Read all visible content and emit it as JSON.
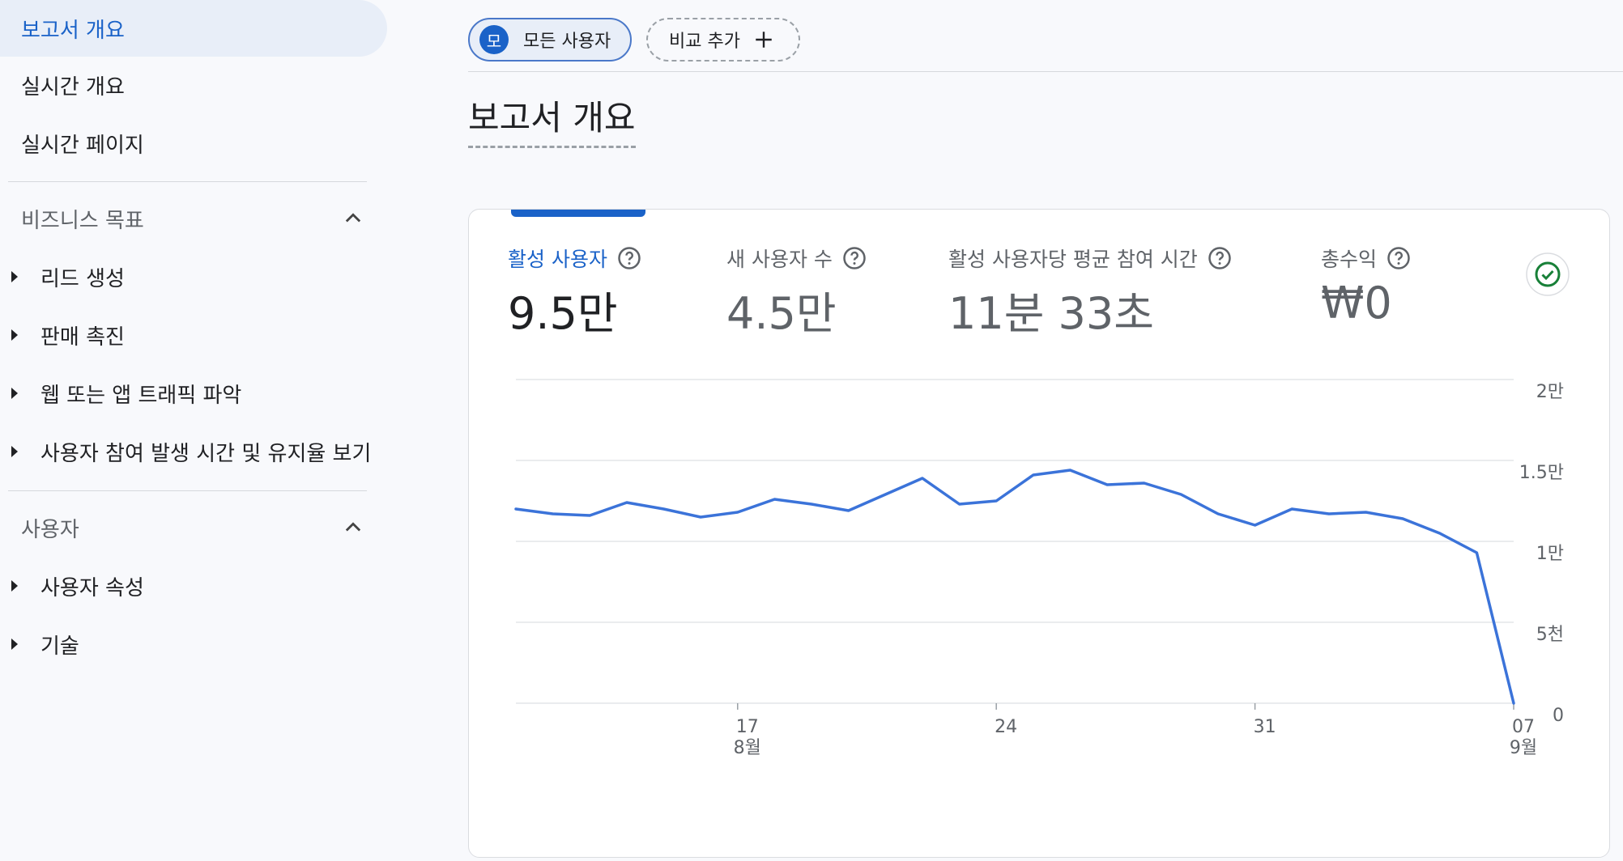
{
  "sidebar": {
    "top_items": [
      "보고서 개요",
      "실시간 개요",
      "실시간 페이지"
    ],
    "sections": [
      {
        "title": "비즈니스 목표",
        "items": [
          "리드 생성",
          "판매 촉진",
          "웹 또는 앱 트래픽 파악",
          "사용자 참여 발생 시간 및 유지율 보기"
        ]
      },
      {
        "title": "사용자",
        "items": [
          "사용자 속성",
          "기술"
        ]
      }
    ]
  },
  "toolbar": {
    "all_users_avatar": "모",
    "all_users_label": "모든 사용자",
    "add_comparison_label": "비교 추가"
  },
  "page": {
    "title": "보고서 개요"
  },
  "metrics": [
    {
      "label": "활성 사용자",
      "value": "9.5만"
    },
    {
      "label": "새 사용자 수",
      "value": "4.5만"
    },
    {
      "label": "활성 사용자당 평균 참여 시간",
      "value": "11분 33초"
    },
    {
      "label": "총수익",
      "value": "₩0"
    }
  ],
  "colors": {
    "accent": "#1a62c8",
    "line": "#3b73d9",
    "check": "#188038"
  },
  "chart_data": {
    "type": "line",
    "series": [
      {
        "values": [
          12000,
          11700,
          11600,
          12400,
          12000,
          11500,
          11800,
          12600,
          12300,
          11900,
          12900,
          13900,
          12300,
          12500,
          14100,
          14400,
          13500,
          13600,
          12900,
          11700,
          11000,
          12000,
          11700,
          11800,
          11400,
          10500,
          9300,
          0
        ]
      }
    ],
    "x_start": "8월 11일",
    "x_end": "9월 7일",
    "x_ticks": [
      {
        "day": "17",
        "month": "8월",
        "index": 6
      },
      {
        "day": "24",
        "month": "",
        "index": 13
      },
      {
        "day": "31",
        "month": "",
        "index": 20
      },
      {
        "day": "07",
        "month": "9월",
        "index": 27
      }
    ],
    "y_ticks": [
      {
        "value": 20000,
        "label": "2만"
      },
      {
        "value": 15000,
        "label": "1.5만"
      },
      {
        "value": 10000,
        "label": "1만"
      },
      {
        "value": 5000,
        "label": "5천"
      },
      {
        "value": 0,
        "label": "0"
      }
    ],
    "ylim": [
      0,
      20000
    ],
    "grid": true,
    "y_axis_side": "right"
  }
}
